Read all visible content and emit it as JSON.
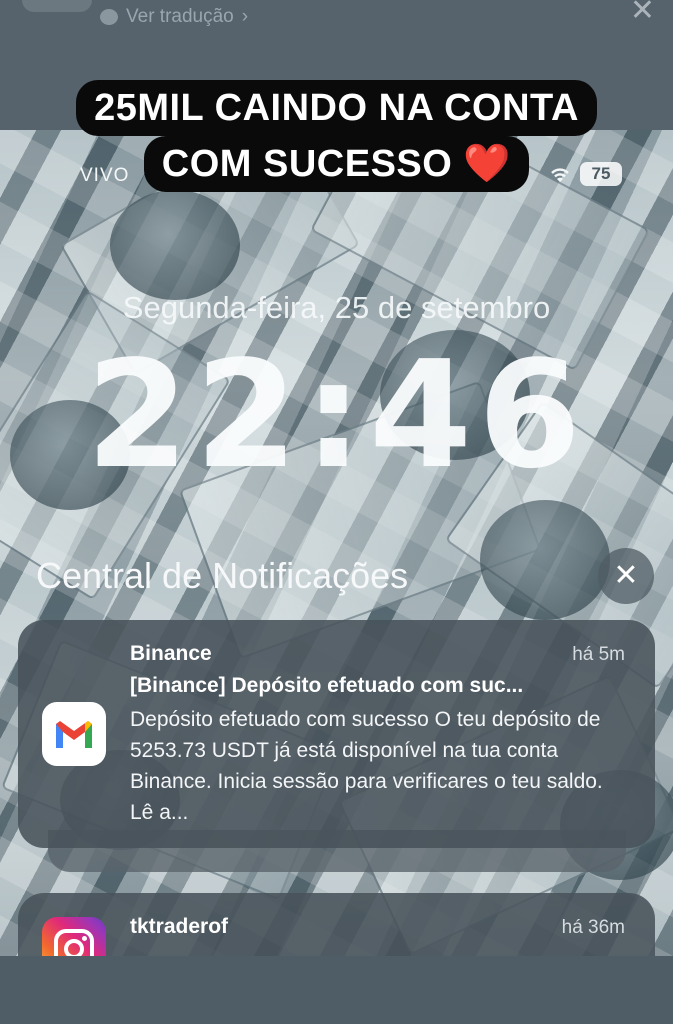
{
  "story": {
    "translate_label": "Ver tradução",
    "translate_chevron": "›",
    "close_label": "✕",
    "caption_line1": "25MIL CAINDO NA CONTA",
    "caption_line2": "COM SUCESSO",
    "caption_heart": "❤️"
  },
  "status_bar": {
    "carrier": "VIVO",
    "battery": "75"
  },
  "lockscreen": {
    "date": "Segunda-feira, 25 de setembro",
    "time": "22:46"
  },
  "notification_center": {
    "title": "Central de Notificações",
    "clear_label": "✕",
    "notifications": [
      {
        "app": "Binance",
        "icon": "gmail-icon",
        "time": "há 5m",
        "title": "[Binance] Depósito efetuado com suc...",
        "body": "Depósito efetuado com sucesso O teu depósito de 5253.73 USDT já está disponível na tua conta Binance. Inicia sessão para verificares o teu saldo. Lê a..."
      },
      {
        "app": "tktraderof",
        "icon": "instagram-icon",
        "time": "há 36m",
        "body": ""
      }
    ]
  },
  "colors": {
    "gmail_red": "#EA4335",
    "gmail_blue": "#4285F4",
    "gmail_green": "#34A853",
    "gmail_yellow": "#FBBC04",
    "heart": "#e0262f"
  }
}
